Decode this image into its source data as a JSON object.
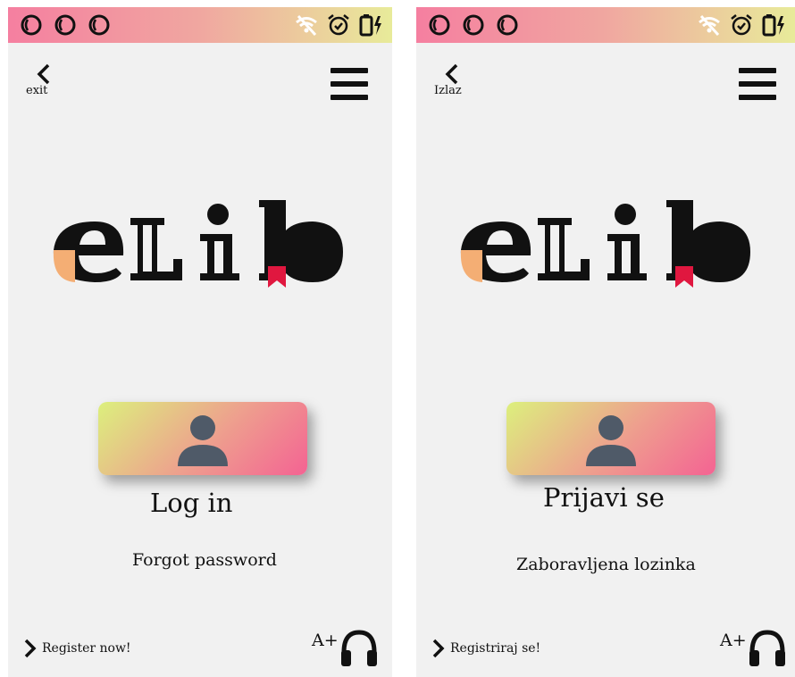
{
  "screens": [
    {
      "language": "en",
      "status_icons": [
        "signal-icon",
        "signal-icon",
        "signal-icon",
        "wifi-off-icon",
        "alarm-icon",
        "battery-charging-icon"
      ],
      "back_label": "exit",
      "logo_text": "eLib",
      "login_label": "Log in",
      "forgot_label": "Forgot password",
      "register_label": "Register now!",
      "font_size_label": "A+"
    },
    {
      "language": "sr",
      "status_icons": [
        "signal-icon",
        "signal-icon",
        "signal-icon",
        "wifi-off-icon",
        "alarm-icon",
        "battery-charging-icon"
      ],
      "back_label": "Izlaz",
      "logo_text": "eLib",
      "login_label": "Prijavi se",
      "forgot_label": "Zaboravljena lozinka",
      "register_label": "Registriraj se!",
      "font_size_label": "A+"
    }
  ],
  "colors": {
    "statusbar_gradient": [
      "#f57fa0",
      "#e8eb9a"
    ],
    "button_gradient": [
      "#dcf07d",
      "#f46393"
    ],
    "bookmark": "#e0173f",
    "logo_accent": "#f4ae74",
    "icon_gray": "#4f5a68"
  }
}
